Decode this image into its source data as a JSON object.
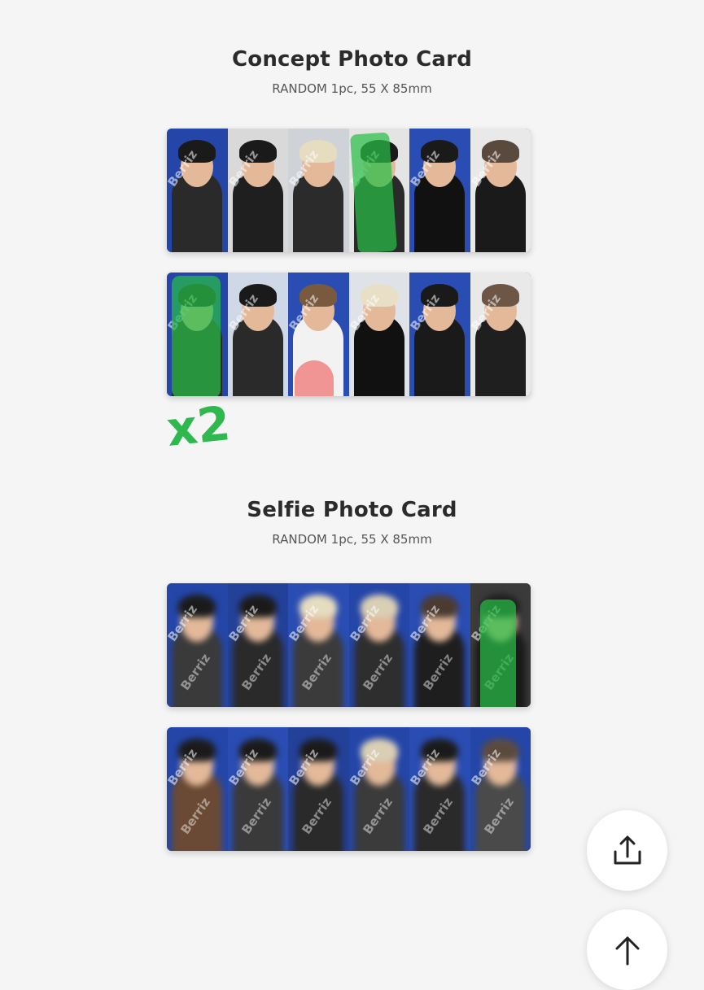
{
  "concept": {
    "title": "Concept Photo Card",
    "subtitle": "RANDOM 1pc, 55 X 85mm"
  },
  "selfie": {
    "title": "Selfie Photo Card",
    "subtitle": "RANDOM 1pc, 55 X 85mm"
  },
  "watermark": "Berriz",
  "annotation": "x2",
  "colors": {
    "card_background_blue": "#1d3da0",
    "highlight_green": "#2fb84e",
    "highlight_red": "#f08a8a",
    "page_background": "#f5f5f5"
  },
  "buttons": {
    "share_icon": "share-icon",
    "scroll_top_icon": "arrow-up-icon"
  }
}
